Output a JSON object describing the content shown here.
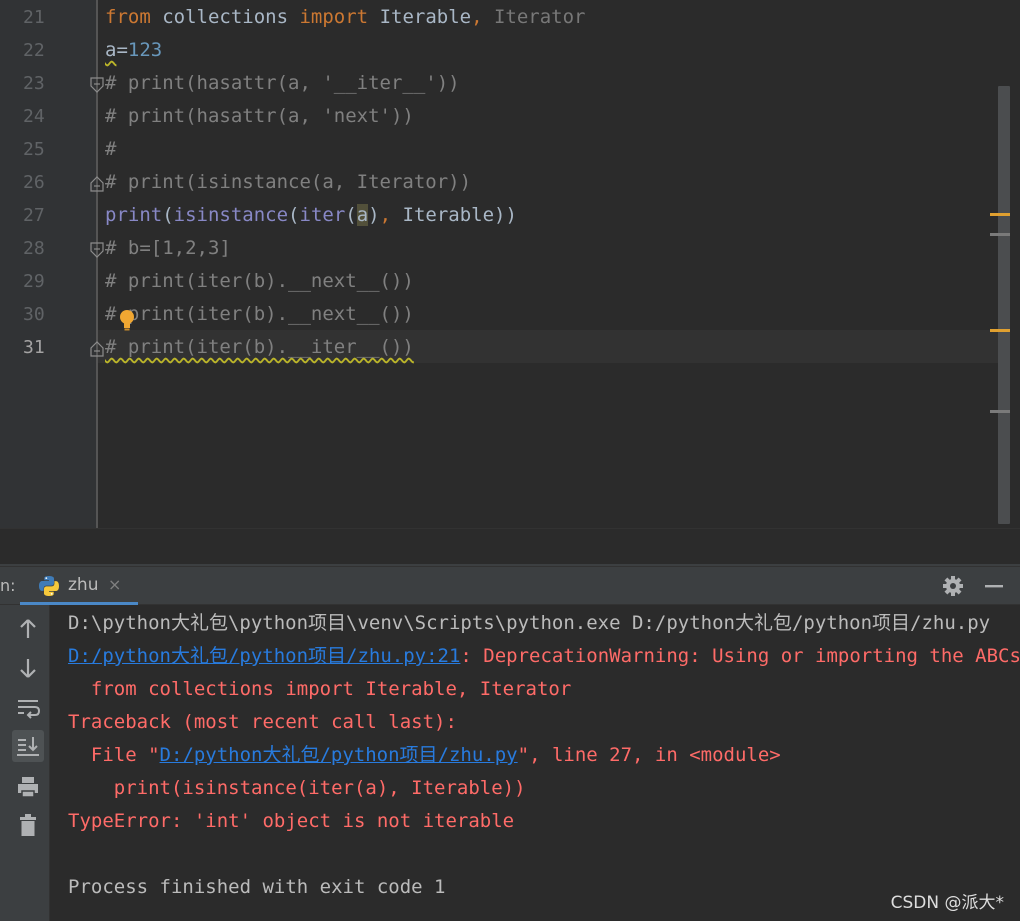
{
  "editor": {
    "line_numbers": [
      "21",
      "22",
      "23",
      "24",
      "25",
      "26",
      "27",
      "28",
      "29",
      "30",
      "31"
    ],
    "active_line": "31",
    "lines": [
      {
        "segments": [
          {
            "t": "from",
            "c": "kw"
          },
          {
            "t": " collections ",
            "c": ""
          },
          {
            "t": "import",
            "c": "kw"
          },
          {
            "t": " Iterable",
            "c": ""
          },
          {
            "t": ",",
            "c": "kw"
          },
          {
            "t": " Iterator",
            "c": "unused"
          }
        ]
      },
      {
        "segments": [
          {
            "t": "a",
            "c": "wavy"
          },
          {
            "t": "=",
            "c": ""
          },
          {
            "t": "123",
            "c": "num"
          }
        ]
      },
      {
        "segments": [
          {
            "t": "# print(hasattr(a, '__iter__'))",
            "c": "cmt"
          }
        ]
      },
      {
        "segments": [
          {
            "t": "# print(hasattr(a, 'next'))",
            "c": "cmt"
          }
        ]
      },
      {
        "segments": [
          {
            "t": "#",
            "c": "cmt"
          }
        ]
      },
      {
        "segments": [
          {
            "t": "# print(isinstance(a, Iterator))",
            "c": "cmt"
          }
        ]
      },
      {
        "segments": [
          {
            "t": "print",
            "c": "builtin"
          },
          {
            "t": "(",
            "c": ""
          },
          {
            "t": "isinstance",
            "c": "builtin"
          },
          {
            "t": "(",
            "c": ""
          },
          {
            "t": "iter",
            "c": "builtin"
          },
          {
            "t": "(",
            "c": ""
          },
          {
            "t": "a",
            "c": "hl-ident"
          },
          {
            "t": ")",
            "c": ""
          },
          {
            "t": ",",
            "c": "kw"
          },
          {
            "t": " Iterable))",
            "c": ""
          }
        ]
      },
      {
        "segments": [
          {
            "t": "# b=[1,2,3]",
            "c": "cmt"
          }
        ]
      },
      {
        "segments": [
          {
            "t": "# print(iter(b).__next__())",
            "c": "cmt"
          }
        ]
      },
      {
        "segments": [
          {
            "t": "# print(iter(b).__next__())",
            "c": "cmt"
          }
        ]
      },
      {
        "segments": [
          {
            "t": "# print(iter(b).__iter__())",
            "c": "cmt wavy"
          }
        ]
      }
    ]
  },
  "run_panel": {
    "label": "n:",
    "tab_label": "zhu",
    "tab_close": "×"
  },
  "console": {
    "lines": [
      {
        "segments": [
          {
            "t": "D:\\python大礼包\\python项目\\venv\\Scripts\\python.exe D:/python大礼包/python项目/zhu.py",
            "c": ""
          }
        ]
      },
      {
        "segments": [
          {
            "t": "D:/python大礼包/python项目/zhu.py:21",
            "c": "link"
          },
          {
            "t": ": DeprecationWarning: Using or importing the ABCs from 'collections' instead of from 'collections.abc' is deprecated",
            "c": "err"
          }
        ]
      },
      {
        "segments": [
          {
            "t": "  from collections import Iterable, Iterator",
            "c": "err"
          }
        ]
      },
      {
        "segments": [
          {
            "t": "Traceback (most recent call last):",
            "c": "err"
          }
        ]
      },
      {
        "segments": [
          {
            "t": "  File \"",
            "c": "err"
          },
          {
            "t": "D:/python大礼包/python项目/zhu.py",
            "c": "link"
          },
          {
            "t": "\", line 27, in <module>",
            "c": "err"
          }
        ]
      },
      {
        "segments": [
          {
            "t": "    print(isinstance(iter(a), Iterable))",
            "c": "err"
          }
        ]
      },
      {
        "segments": [
          {
            "t": "TypeError: 'int' object is not iterable",
            "c": "err"
          }
        ]
      },
      {
        "segments": [
          {
            "t": "",
            "c": ""
          }
        ]
      },
      {
        "segments": [
          {
            "t": "Process finished with exit code 1",
            "c": ""
          }
        ]
      }
    ]
  },
  "watermark": "CSDN @派大*",
  "colors": {
    "editor_bg": "#2b2b2b",
    "keyword": "#cc7832",
    "number": "#6897bb",
    "comment": "#808080",
    "builtin": "#8888c6",
    "error": "#ff6b68",
    "link": "#287bde",
    "warning_marker": "#e0a030"
  }
}
